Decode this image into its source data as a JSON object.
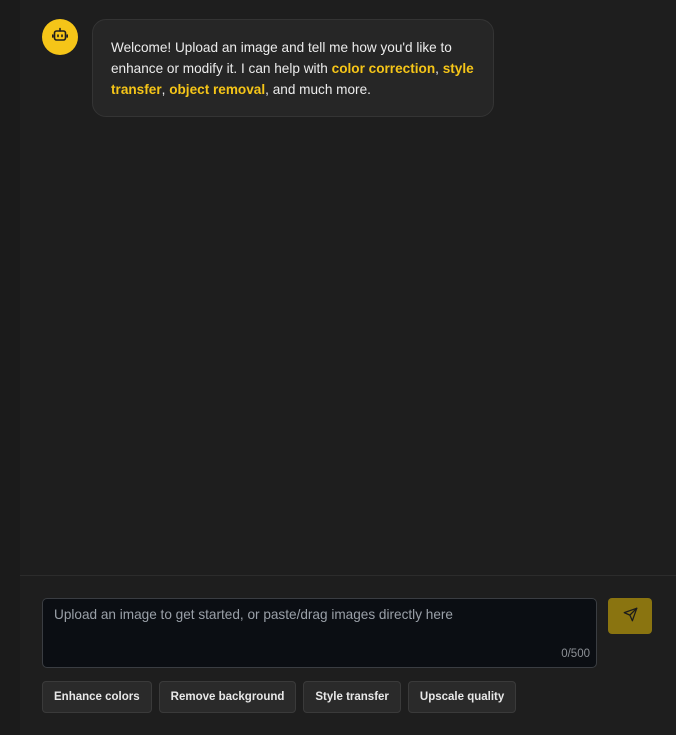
{
  "assistant": {
    "icon": "robot-icon",
    "message": {
      "part1": "Welcome! Upload an image and tell me how you'd like to enhance or modify it. I can help with ",
      "hl1": "color correction",
      "sep1": ", ",
      "hl2": "style transfer",
      "sep2": ", ",
      "hl3": "object removal",
      "part2": ", and much more."
    }
  },
  "composer": {
    "placeholder": "Upload an image to get started, or paste/drag images directly here",
    "counter": "0/500",
    "send_icon": "send-icon"
  },
  "suggestions": [
    {
      "label": "Enhance colors"
    },
    {
      "label": "Remove background"
    },
    {
      "label": "Style transfer"
    },
    {
      "label": "Upscale quality"
    }
  ],
  "colors": {
    "accent": "#f5c518",
    "send_button": "#8a7410",
    "background": "#1e1e1e",
    "bubble": "#262626",
    "input": "#0b0e13"
  }
}
